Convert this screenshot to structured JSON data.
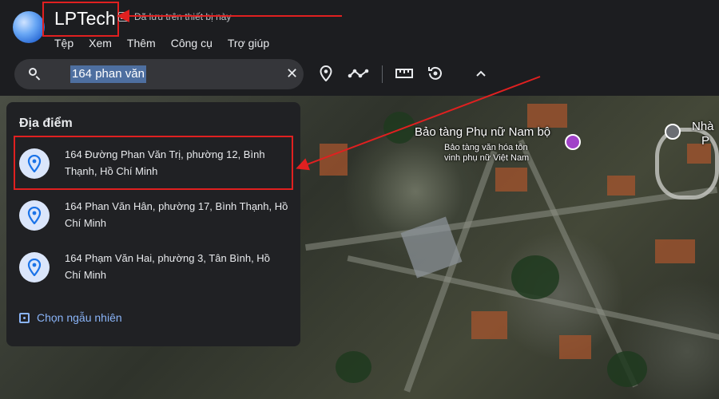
{
  "app": {
    "title": "LPTech",
    "saved_status": "Đã lưu trên thiết bị này"
  },
  "menu": [
    "Tệp",
    "Xem",
    "Thêm",
    "Công cụ",
    "Trợ giúp"
  ],
  "search": {
    "value": "164 phan văn"
  },
  "toolbar": {
    "icons": [
      "add-placemark-icon",
      "add-path-icon",
      "measure-icon",
      "history-icon",
      "collapse-chevron-icon"
    ]
  },
  "dropdown": {
    "title": "Địa điểm",
    "results": [
      {
        "line1": "164 Đường Phan Văn Trị, phường 12, Bình",
        "line2": "Thạnh, Hồ Chí Minh"
      },
      {
        "line1": "164 Phan Văn Hân, phường 17, Bình Thạnh, Hồ",
        "line2": "Chí Minh"
      },
      {
        "line1": "164 Phạm Văn Hai, phường 3, Tân Bình, Hồ",
        "line2": "Chí Minh"
      }
    ],
    "random_label": "Chọn ngẫu nhiên"
  },
  "map": {
    "labels": {
      "museum": "Bảo tàng Phụ nữ Nam bộ",
      "museum_sub1": "Bảo tàng văn hóa tôn",
      "museum_sub2": "vinh phụ nữ Việt Nam",
      "edge1": "Nhà",
      "edge2": "P"
    }
  },
  "colors": {
    "accent": "#8ab4f8",
    "annotation": "#e02020",
    "background": "#1c1d20"
  }
}
